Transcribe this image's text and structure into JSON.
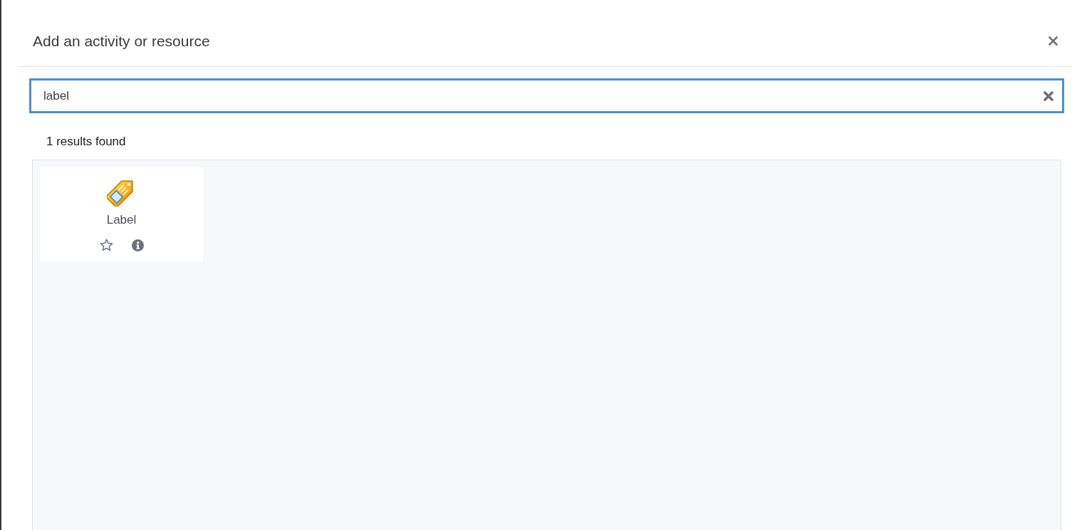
{
  "dialog": {
    "title": "Add an activity or resource"
  },
  "search": {
    "value": "label",
    "focused": true
  },
  "results_summary": "1 results found",
  "results": [
    {
      "name": "Label",
      "starred": false
    }
  ]
}
